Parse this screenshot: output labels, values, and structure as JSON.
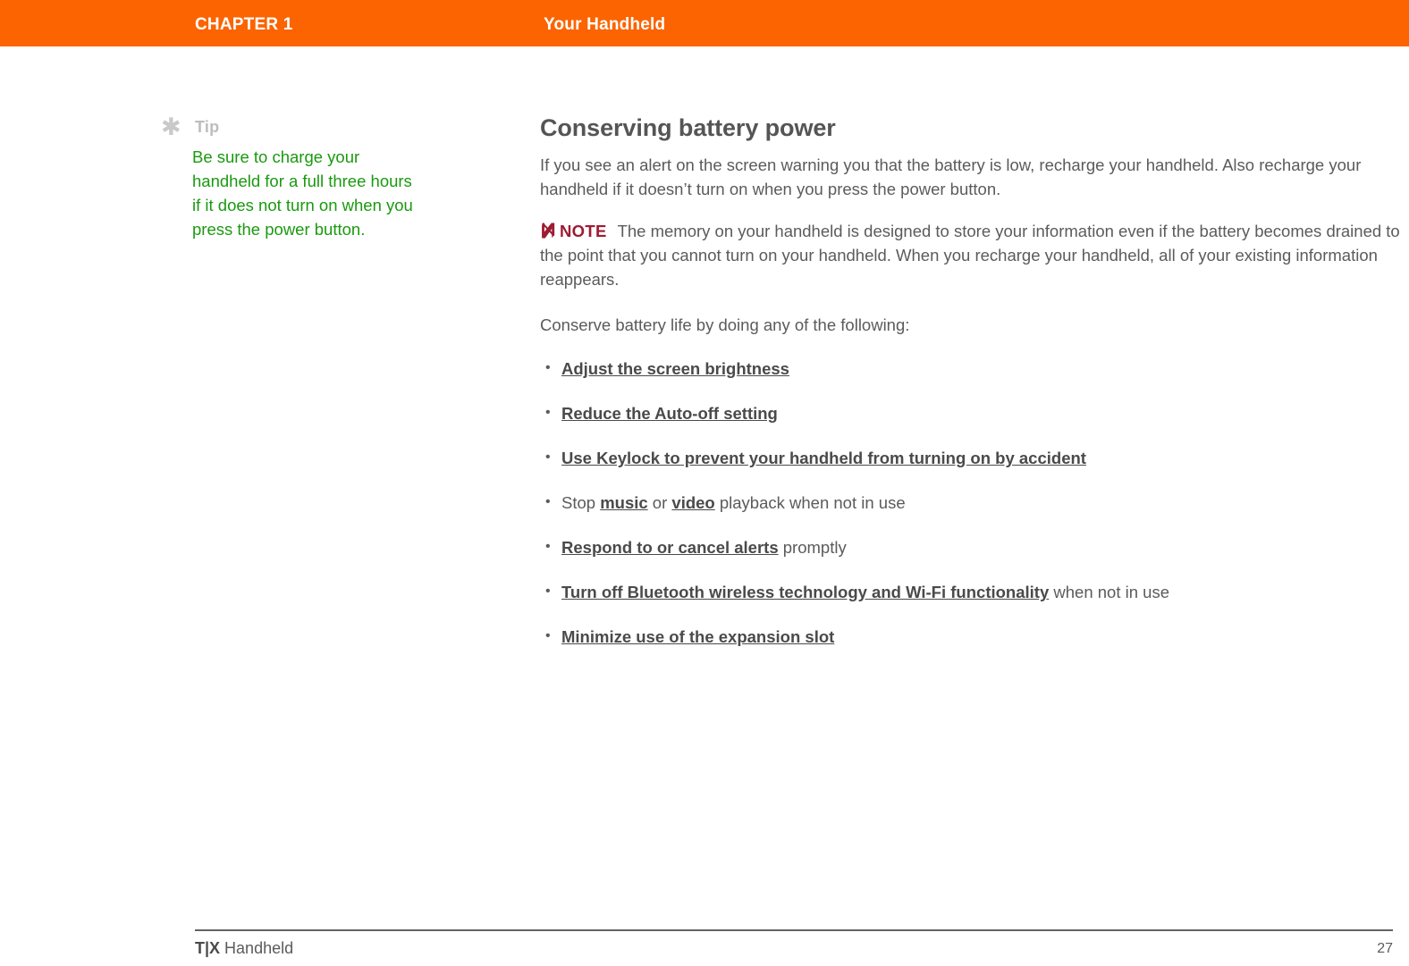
{
  "header": {
    "chapter_label": "CHAPTER 1",
    "chapter_title": "Your Handheld",
    "background_color": "#fb6400",
    "text_color": "#ffffff"
  },
  "tip": {
    "icon": "asterisk-icon",
    "label": "Tip",
    "body": "Be sure to charge your handheld for a full three hours if it does not turn on when you press the power button.",
    "text_color": "#1a9a0f",
    "label_color": "#bdbdbd"
  },
  "main": {
    "heading": "Conserving battery power",
    "intro_paragraph": "If you see an alert on the screen warning you that the battery is low, recharge your handheld. Also recharge your handheld if it doesn’t turn on when you press the power button.",
    "note": {
      "icon": "note-n-icon",
      "label": "NOTE",
      "label_color": "#9e1b32",
      "text": "The memory on your handheld is designed to store your information even if the battery becomes drained to the point that you cannot turn on your handheld. When you recharge your handheld, all of your existing information reappears."
    },
    "list_intro": "Conserve battery life by doing any of the following:",
    "bullets": [
      {
        "link": "Adjust the screen brightness",
        "before": "",
        "middle": "",
        "link2": "",
        "after": ""
      },
      {
        "link": "Reduce the Auto-off setting",
        "before": "",
        "middle": "",
        "link2": "",
        "after": ""
      },
      {
        "link": "Use Keylock to prevent your handheld from turning on by accident",
        "before": "",
        "middle": "",
        "link2": "",
        "after": ""
      },
      {
        "link": "music",
        "before": "Stop ",
        "middle": " or ",
        "link2": "video",
        "after": " playback when not in use"
      },
      {
        "link": "Respond to or cancel alerts",
        "before": "",
        "middle": "",
        "link2": "",
        "after": " promptly"
      },
      {
        "link": "Turn off Bluetooth wireless technology and Wi-Fi functionality",
        "before": "",
        "middle": "",
        "link2": "",
        "after": " when not in use"
      },
      {
        "link": "Minimize use of the expansion slot",
        "before": "",
        "middle": "",
        "link2": "",
        "after": ""
      }
    ]
  },
  "footer": {
    "product_mark": "T|X",
    "product_name": " Handheld",
    "page_number": "27"
  }
}
